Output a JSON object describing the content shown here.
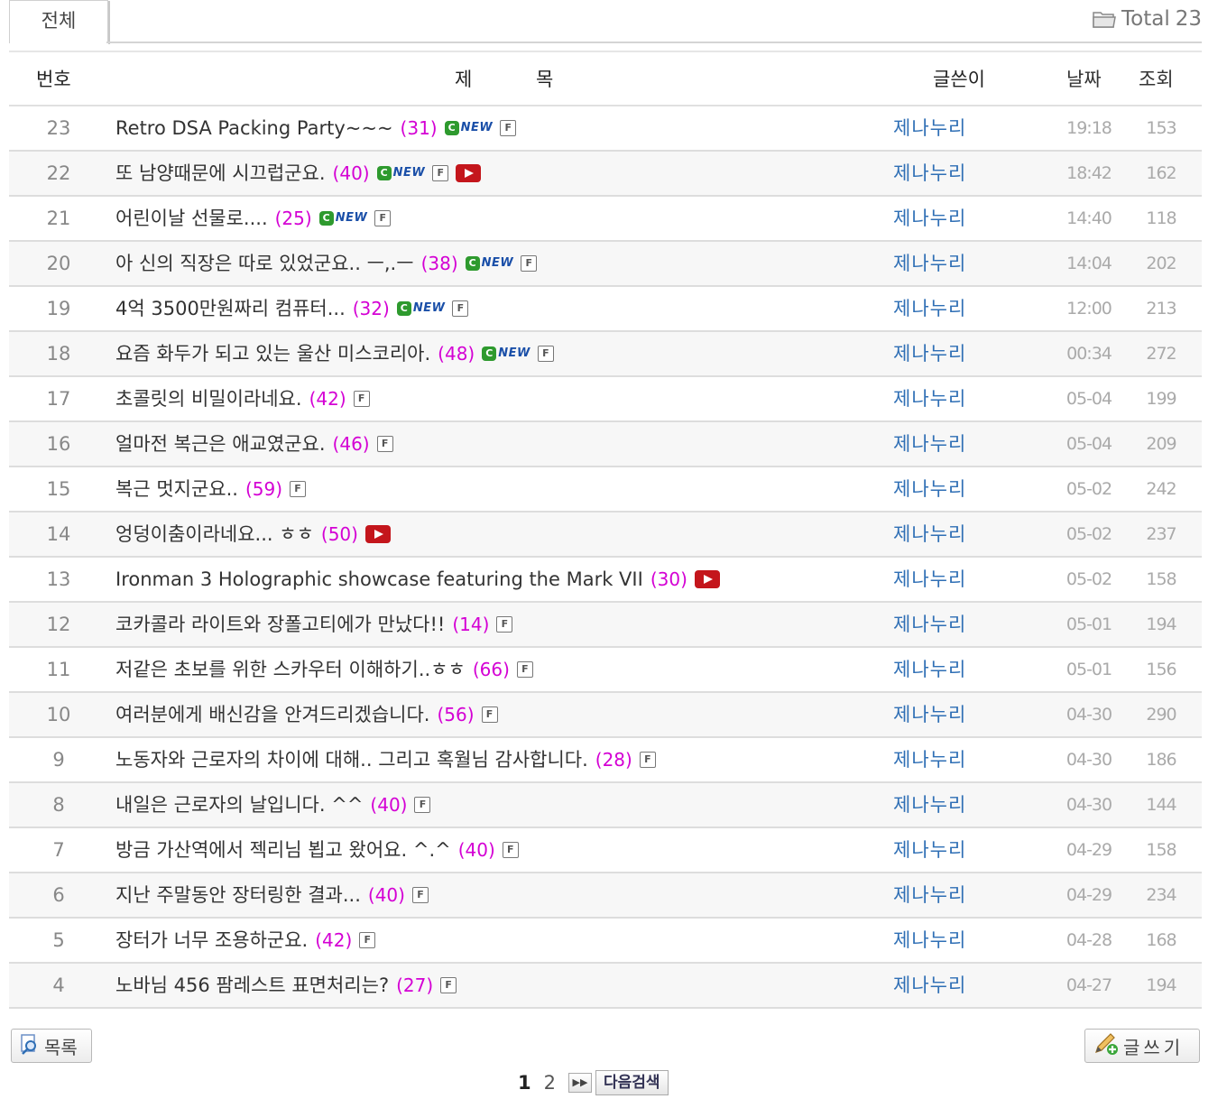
{
  "tabs": {
    "all_label": "전체"
  },
  "total": {
    "label": "Total",
    "count": "23"
  },
  "columns": {
    "num": "번호",
    "title": "제 목",
    "author": "글쓴이",
    "date": "날짜",
    "views": "조회"
  },
  "icons": {
    "new_text": "NEW",
    "f_text": "F"
  },
  "rows": [
    {
      "num": "23",
      "title": "Retro DSA Packing Party~~~",
      "count": "(31)",
      "new": true,
      "f": true,
      "yt": false,
      "author": "제나누리",
      "date": "19:18",
      "views": "153"
    },
    {
      "num": "22",
      "title": "또 남양때문에 시끄럽군요.",
      "count": "(40)",
      "new": true,
      "f": true,
      "yt": true,
      "author": "제나누리",
      "date": "18:42",
      "views": "162"
    },
    {
      "num": "21",
      "title": "어린이날 선물로....",
      "count": "(25)",
      "new": true,
      "f": true,
      "yt": false,
      "author": "제나누리",
      "date": "14:40",
      "views": "118"
    },
    {
      "num": "20",
      "title": "아 신의 직장은 따로 있었군요.. ㅡ,.ㅡ",
      "count": "(38)",
      "new": true,
      "f": true,
      "yt": false,
      "author": "제나누리",
      "date": "14:04",
      "views": "202"
    },
    {
      "num": "19",
      "title": "4억 3500만원짜리 컴퓨터...",
      "count": "(32)",
      "new": true,
      "f": true,
      "yt": false,
      "author": "제나누리",
      "date": "12:00",
      "views": "213"
    },
    {
      "num": "18",
      "title": "요즘 화두가 되고 있는 울산 미스코리아.",
      "count": "(48)",
      "new": true,
      "f": true,
      "yt": false,
      "author": "제나누리",
      "date": "00:34",
      "views": "272"
    },
    {
      "num": "17",
      "title": "초콜릿의 비밀이라네요.",
      "count": "(42)",
      "new": false,
      "f": true,
      "yt": false,
      "author": "제나누리",
      "date": "05-04",
      "views": "199"
    },
    {
      "num": "16",
      "title": "얼마전 복근은 애교였군요.",
      "count": "(46)",
      "new": false,
      "f": true,
      "yt": false,
      "author": "제나누리",
      "date": "05-04",
      "views": "209"
    },
    {
      "num": "15",
      "title": "복근 멋지군요..",
      "count": "(59)",
      "new": false,
      "f": true,
      "yt": false,
      "author": "제나누리",
      "date": "05-02",
      "views": "242"
    },
    {
      "num": "14",
      "title": "엉덩이춤이라네요... ㅎㅎ",
      "count": "(50)",
      "new": false,
      "f": false,
      "yt": true,
      "author": "제나누리",
      "date": "05-02",
      "views": "237"
    },
    {
      "num": "13",
      "title": "Ironman 3 Holographic showcase featuring the Mark VII",
      "count": "(30)",
      "new": false,
      "f": false,
      "yt": true,
      "author": "제나누리",
      "date": "05-02",
      "views": "158"
    },
    {
      "num": "12",
      "title": "코카콜라 라이트와 장폴고티에가 만났다!!",
      "count": "(14)",
      "new": false,
      "f": true,
      "yt": false,
      "author": "제나누리",
      "date": "05-01",
      "views": "194"
    },
    {
      "num": "11",
      "title": "저같은 초보를 위한 스카우터 이해하기..ㅎㅎ",
      "count": "(66)",
      "new": false,
      "f": true,
      "yt": false,
      "author": "제나누리",
      "date": "05-01",
      "views": "156"
    },
    {
      "num": "10",
      "title": "여러분에게 배신감을 안겨드리겠습니다.",
      "count": "(56)",
      "new": false,
      "f": true,
      "yt": false,
      "author": "제나누리",
      "date": "04-30",
      "views": "290"
    },
    {
      "num": "9",
      "title": "노동자와 근로자의 차이에 대해.. 그리고 혹월님 감사합니다.",
      "count": "(28)",
      "new": false,
      "f": true,
      "yt": false,
      "author": "제나누리",
      "date": "04-30",
      "views": "186"
    },
    {
      "num": "8",
      "title": "내일은 근로자의 날입니다. ^^",
      "count": "(40)",
      "new": false,
      "f": true,
      "yt": false,
      "author": "제나누리",
      "date": "04-30",
      "views": "144"
    },
    {
      "num": "7",
      "title": "방금 가산역에서 젝리님 뵙고 왔어요. ^.^",
      "count": "(40)",
      "new": false,
      "f": true,
      "yt": false,
      "author": "제나누리",
      "date": "04-29",
      "views": "158"
    },
    {
      "num": "6",
      "title": "지난 주말동안 장터링한 결과...",
      "count": "(40)",
      "new": false,
      "f": true,
      "yt": false,
      "author": "제나누리",
      "date": "04-29",
      "views": "234"
    },
    {
      "num": "5",
      "title": "장터가 너무 조용하군요.",
      "count": "(42)",
      "new": false,
      "f": true,
      "yt": false,
      "author": "제나누리",
      "date": "04-28",
      "views": "168"
    },
    {
      "num": "4",
      "title": "노바님 456 팜레스트 표면처리는?",
      "count": "(27)",
      "new": false,
      "f": true,
      "yt": false,
      "author": "제나누리",
      "date": "04-27",
      "views": "194"
    }
  ],
  "buttons": {
    "list_label": "목록",
    "write_label": "글쓰기"
  },
  "pagination": {
    "current": "1",
    "pages": [
      "2"
    ],
    "next_search_label": "다음검색"
  },
  "colors": {
    "comment_count": "#d400d4",
    "author_link": "#2f6fb5",
    "youtube_red": "#c4161c",
    "new_green": "#2e9a2e",
    "new_blue": "#1a4fa8"
  }
}
